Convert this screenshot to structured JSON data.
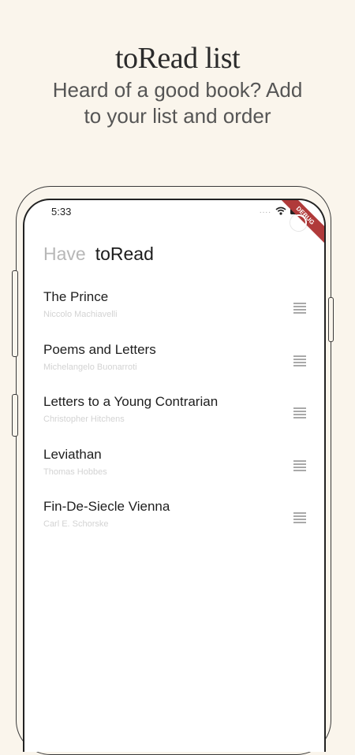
{
  "promo": {
    "title": "toRead list",
    "subtitle": "Heard of a good book? Add to your list and order"
  },
  "status_bar": {
    "time": "5:33",
    "signal": "....",
    "debug_banner": "DEBUG"
  },
  "tabs": [
    {
      "label": "Have",
      "active": false
    },
    {
      "label": "toRead",
      "active": true
    }
  ],
  "books": [
    {
      "title": "The Prince",
      "author": "Niccolo Machiavelli"
    },
    {
      "title": "Poems and Letters",
      "author": "Michelangelo Buonarroti"
    },
    {
      "title": "Letters to a Young Contrarian",
      "author": "Christopher Hitchens"
    },
    {
      "title": "Leviathan",
      "author": "Thomas Hobbes"
    },
    {
      "title": "Fin-De-Siecle Vienna",
      "author": "Carl E. Schorske"
    }
  ],
  "colors": {
    "background": "#faf5ec",
    "screen": "#ffffff",
    "active_tab": "#1c1c1c",
    "inactive_tab": "#b7b7b7",
    "author_text": "#d3d3d3",
    "debug_ribbon": "#b03a3a"
  },
  "icons": {
    "drag_handle": "drag-handle-icon",
    "wifi": "wifi-icon",
    "battery": "battery-icon"
  }
}
